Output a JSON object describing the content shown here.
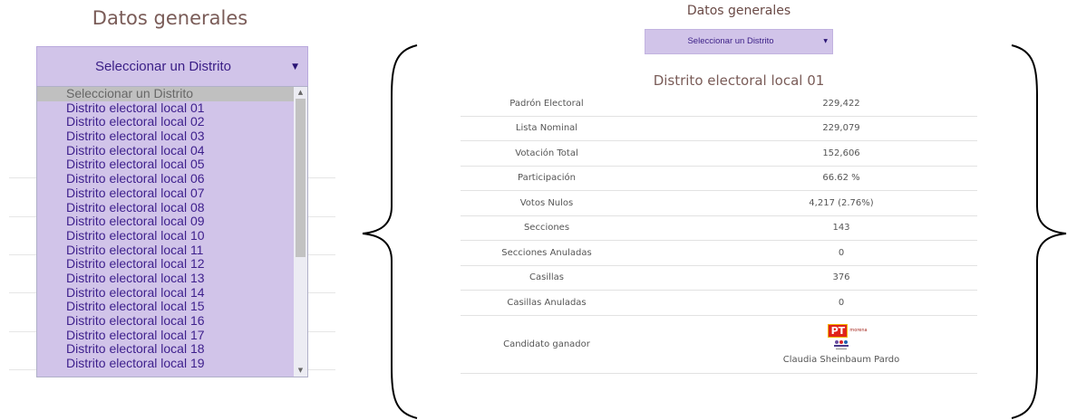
{
  "left": {
    "title": "Datos generales",
    "select": {
      "selected": "Seleccionar un Distrito"
    },
    "options": [
      "Seleccionar un Distrito",
      "Distrito electoral local 01",
      "Distrito electoral local 02",
      "Distrito electoral local 03",
      "Distrito electoral local 04",
      "Distrito electoral local 05",
      "Distrito electoral local 06",
      "Distrito electoral local 07",
      "Distrito electoral local 08",
      "Distrito electoral local 09",
      "Distrito electoral local 10",
      "Distrito electoral local 11",
      "Distrito electoral local 12",
      "Distrito electoral local 13",
      "Distrito electoral local 14",
      "Distrito electoral local 15",
      "Distrito electoral local 16",
      "Distrito electoral local 17",
      "Distrito electoral local 18",
      "Distrito electoral local 19"
    ]
  },
  "right": {
    "title": "Datos generales",
    "select": {
      "selected": "Seleccionar un Distrito"
    },
    "district_title": "Distrito electoral local 01",
    "stats": [
      {
        "label": "Padrón Electoral",
        "value": "229,422"
      },
      {
        "label": "Lista Nominal",
        "value": "229,079"
      },
      {
        "label": "Votación Total",
        "value": "152,606"
      },
      {
        "label": "Participación",
        "value": "66.62 %"
      },
      {
        "label": "Votos Nulos",
        "value": "4,217 (2.76%)"
      },
      {
        "label": "Secciones",
        "value": "143"
      },
      {
        "label": "Secciones Anuladas",
        "value": "0"
      },
      {
        "label": "Casillas",
        "value": "376"
      },
      {
        "label": "Casillas Anuladas",
        "value": "0"
      }
    ],
    "winner": {
      "label": "Candidato ganador",
      "logo_pt": "PT",
      "logo_morena": "morena",
      "name": "Claudia Sheinbaum Pardo"
    }
  },
  "colors": {
    "select_bg": "#d1c4e9",
    "select_text": "#3a1e86",
    "title_text": "#7a5c58",
    "selected_option_bg": "#c0c0c0"
  },
  "icons": [
    "caret-down-icon",
    "scroll-up-icon",
    "scroll-down-icon",
    "left-curly-brace",
    "right-curly-brace",
    "pt-party-logo",
    "morena-party-logo",
    "pes-party-logo"
  ]
}
